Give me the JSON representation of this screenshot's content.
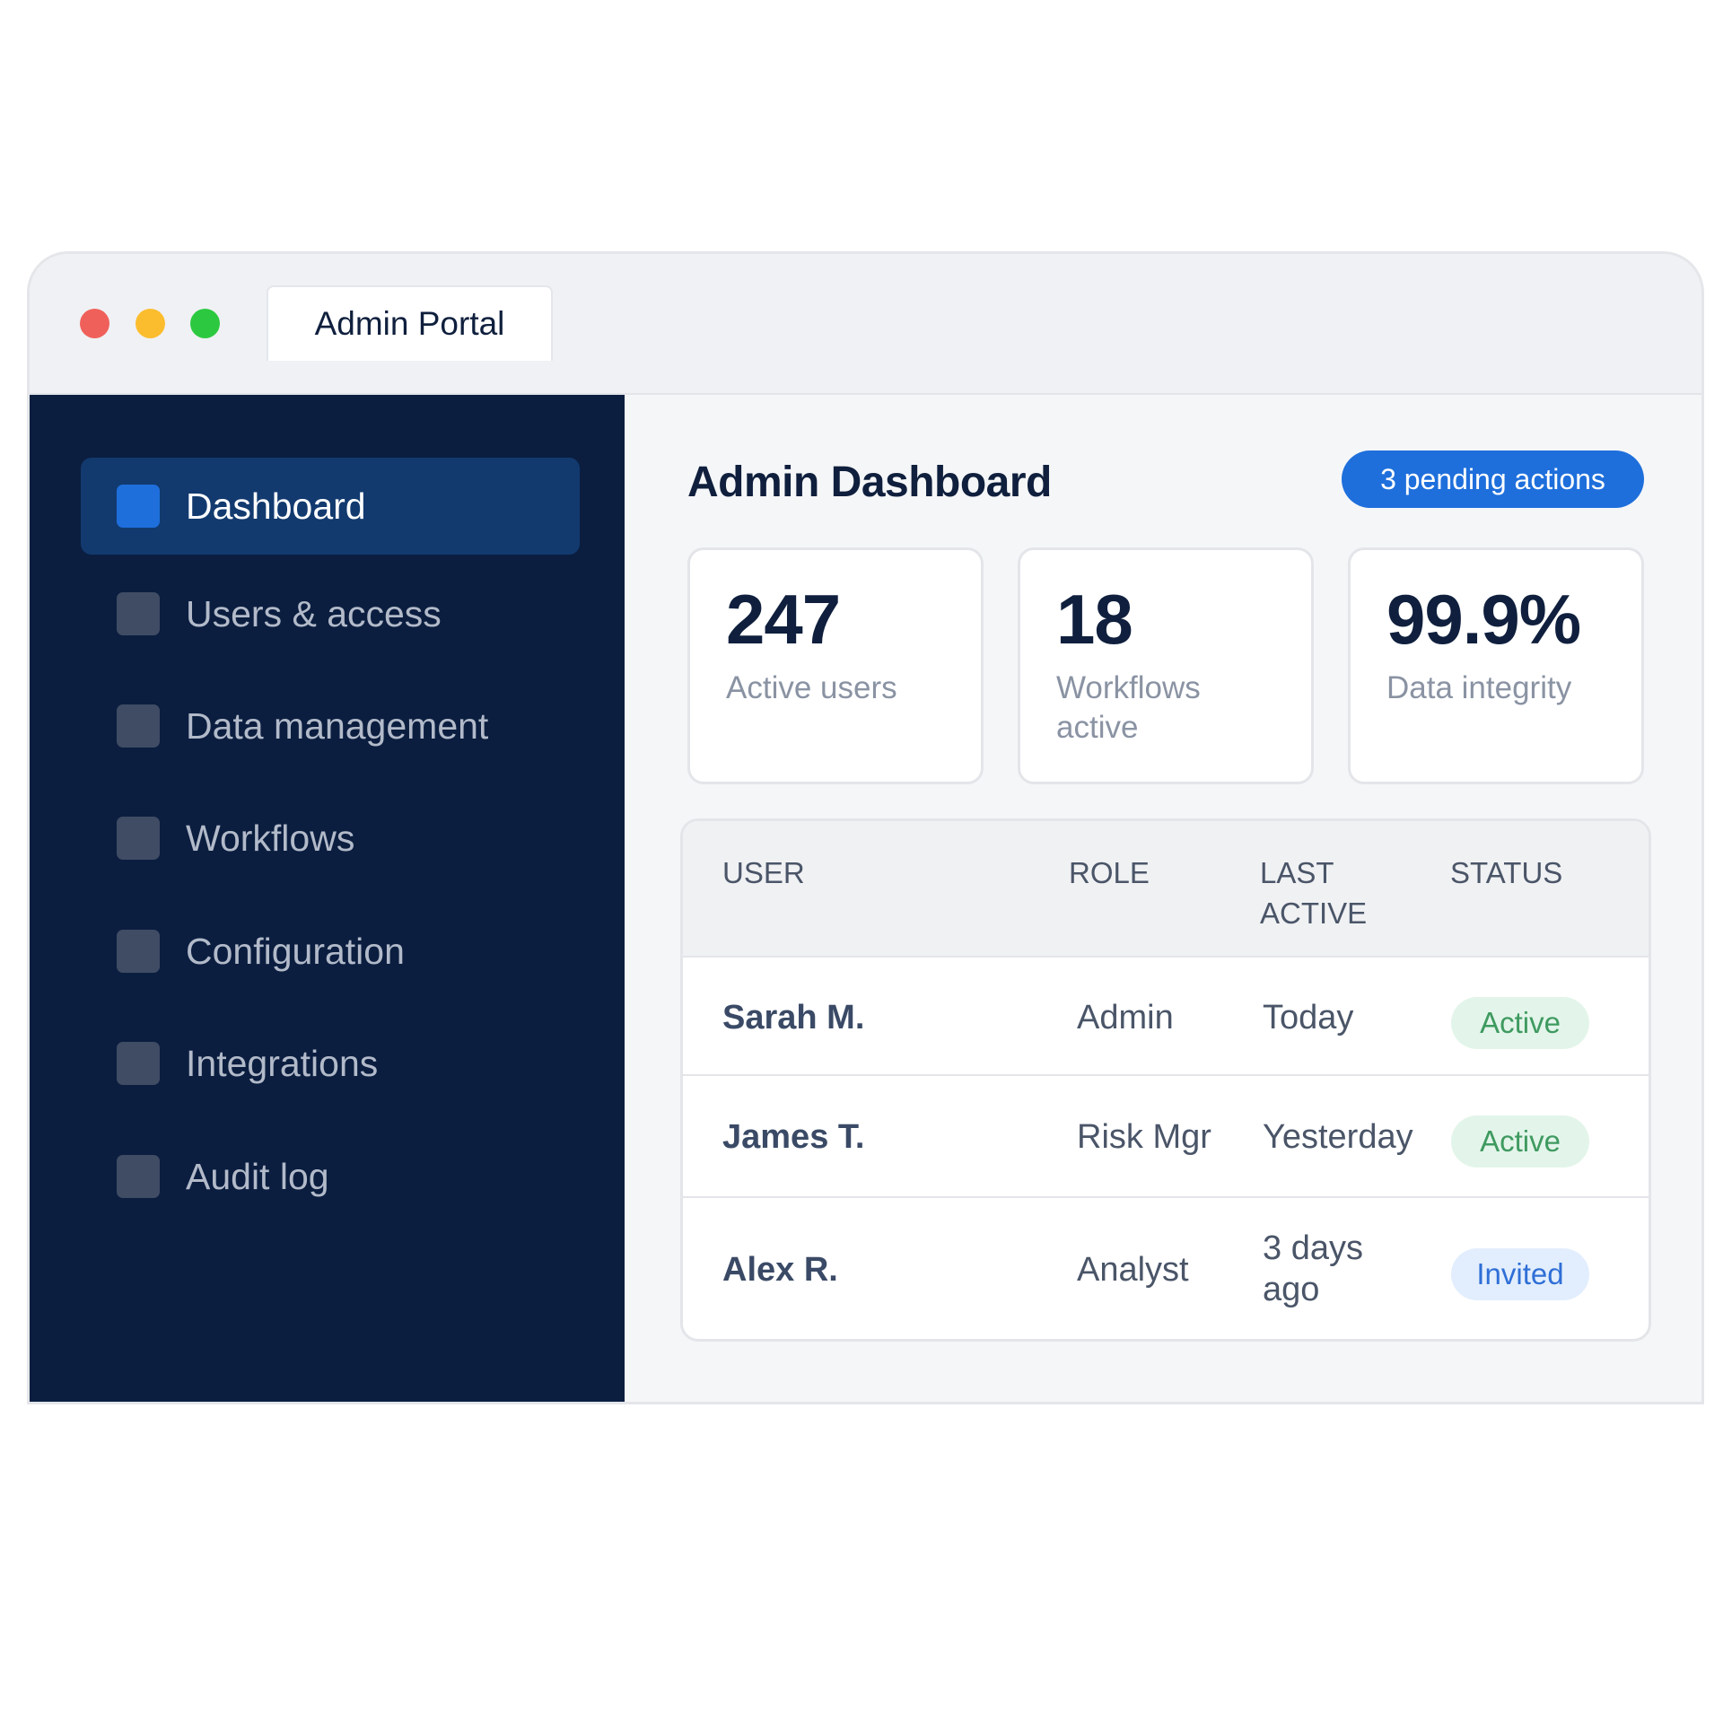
{
  "window": {
    "tab_title": "Admin Portal"
  },
  "sidebar": {
    "items": [
      {
        "label": "Dashboard",
        "active": true
      },
      {
        "label": "Users & access",
        "active": false
      },
      {
        "label": "Data management",
        "active": false
      },
      {
        "label": "Workflows",
        "active": false
      },
      {
        "label": "Configuration",
        "active": false
      },
      {
        "label": "Integrations",
        "active": false
      },
      {
        "label": "Audit log",
        "active": false
      }
    ]
  },
  "main": {
    "title": "Admin Dashboard",
    "pending_badge": "3 pending actions",
    "stats": [
      {
        "value": "247",
        "label": "Active users"
      },
      {
        "value": "18",
        "label": "Workflows active"
      },
      {
        "value": "99.9%",
        "label": "Data integrity"
      }
    ],
    "table": {
      "headers": [
        "USER",
        "ROLE",
        "LAST ACTIVE",
        "STATUS"
      ],
      "rows": [
        {
          "user": "Sarah M.",
          "role": "Admin",
          "last_active": "Today",
          "status": "Active"
        },
        {
          "user": "James T.",
          "role": "Risk Mgr",
          "last_active": "Yesterday",
          "status": "Active"
        },
        {
          "user": "Alex R.",
          "role": "Analyst",
          "last_active": "3 days ago",
          "status": "Invited"
        }
      ]
    }
  },
  "colors": {
    "sidebar_bg": "#0b1e40",
    "sidebar_active_bg": "#123a6f",
    "accent": "#1e6fdc",
    "status_active": "#3f9a60",
    "status_invited": "#2f6fd6"
  },
  "icons": [
    "close-dot-icon",
    "minimize-dot-icon",
    "maximize-dot-icon",
    "nav-square-icon"
  ]
}
